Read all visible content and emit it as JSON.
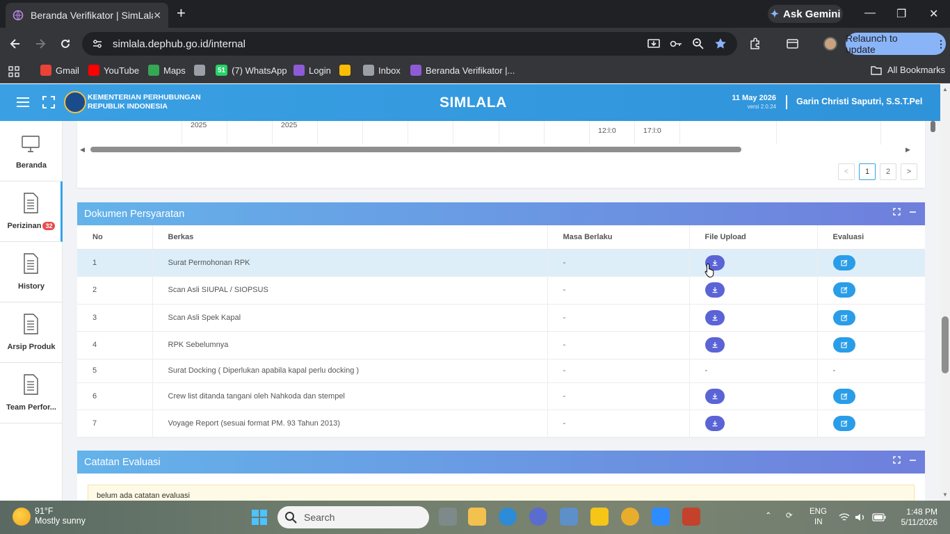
{
  "browser": {
    "tab_title": "Beranda Verifikator | SimLala",
    "tab_close": "✕",
    "new_tab": "+",
    "gemini_label": "Ask Gemini",
    "url": "simlala.dephub.go.id/internal",
    "relaunch_label": "Relaunch to update",
    "relaunch_menu": "⋮",
    "window_minimize": "—",
    "window_maximize": "❐",
    "window_close": "✕",
    "bookmarks": [
      {
        "label": "Gmail",
        "color": "#ea4335"
      },
      {
        "label": "YouTube",
        "color": "#ff0000"
      },
      {
        "label": "Maps",
        "color": "#34a853"
      },
      {
        "label": "",
        "color": "#9aa0a6"
      },
      {
        "label": "(7) WhatsApp",
        "color": "#25d366",
        "badge": "51"
      },
      {
        "label": "Login",
        "color": "#8e5bd6"
      },
      {
        "label": "",
        "color": "#fbbc05"
      },
      {
        "label": "Inbox",
        "color": "#9aa0a6"
      },
      {
        "label": "Beranda Verifikator |...",
        "color": "#8e5bd6"
      }
    ],
    "all_bookmarks": "All Bookmarks"
  },
  "app": {
    "ministry_line1": "KEMENTERIAN PERHUBUNGAN",
    "ministry_line2": "REPUBLIK INDONESIA",
    "title": "SIMLALA",
    "date": "11 May 2026",
    "version": "versi 2.0.24",
    "user": "Garin Christi Saputri, S.S.T.Pel"
  },
  "sidebar": {
    "items": [
      {
        "label": "Beranda"
      },
      {
        "label": "Perizinan",
        "badge": "32"
      },
      {
        "label": "History"
      },
      {
        "label": "Arsip Produk"
      },
      {
        "label": "Team Perfor..."
      }
    ]
  },
  "top_table": {
    "row_fragments": [
      "2025",
      "2025",
      "12:l:0",
      "17:l:0"
    ],
    "pager": {
      "prev": "<",
      "pages": [
        "1",
        "2"
      ],
      "current": "1",
      "next": ">"
    }
  },
  "dokumen": {
    "title": "Dokumen Persyaratan",
    "columns": [
      "No",
      "Berkas",
      "Masa Berlaku",
      "File Upload",
      "Evaluasi"
    ],
    "rows": [
      {
        "no": "1",
        "berkas": "Surat Permohonan RPK",
        "masa": "-",
        "has_file": true
      },
      {
        "no": "2",
        "berkas": "Scan Asli SIUPAL / SIOPSUS",
        "masa": "-",
        "has_file": true
      },
      {
        "no": "3",
        "berkas": "Scan Asli Spek Kapal",
        "masa": "-",
        "has_file": true
      },
      {
        "no": "4",
        "berkas": "RPK Sebelumnya",
        "masa": "-",
        "has_file": true
      },
      {
        "no": "5",
        "berkas": "Surat Docking ( Diperlukan apabila kapal perlu docking )",
        "masa": "-",
        "has_file": false,
        "file_text": "-",
        "eval_text": "-"
      },
      {
        "no": "6",
        "berkas": "Crew list ditanda tangani oleh Nahkoda dan stempel",
        "masa": "-",
        "has_file": true
      },
      {
        "no": "7",
        "berkas": "Voyage Report (sesuai format PM. 93 Tahun 2013)",
        "masa": "-",
        "has_file": true
      }
    ]
  },
  "catatan": {
    "title": "Catatan Evaluasi",
    "empty_text": "belum ada catatan evaluasi"
  },
  "taskbar": {
    "temp": "91°F",
    "weather": "Mostly sunny",
    "search_placeholder": "Search",
    "lang1": "ENG",
    "lang2": "IN",
    "time": "1:48 PM",
    "date": "5/11/2026"
  },
  "colors": {
    "accent": "#36a3e8",
    "header": "#3aa0e3",
    "download_btn": "#5a64d6",
    "edit_btn": "#2a9de8",
    "badge": "#e94a4a"
  }
}
